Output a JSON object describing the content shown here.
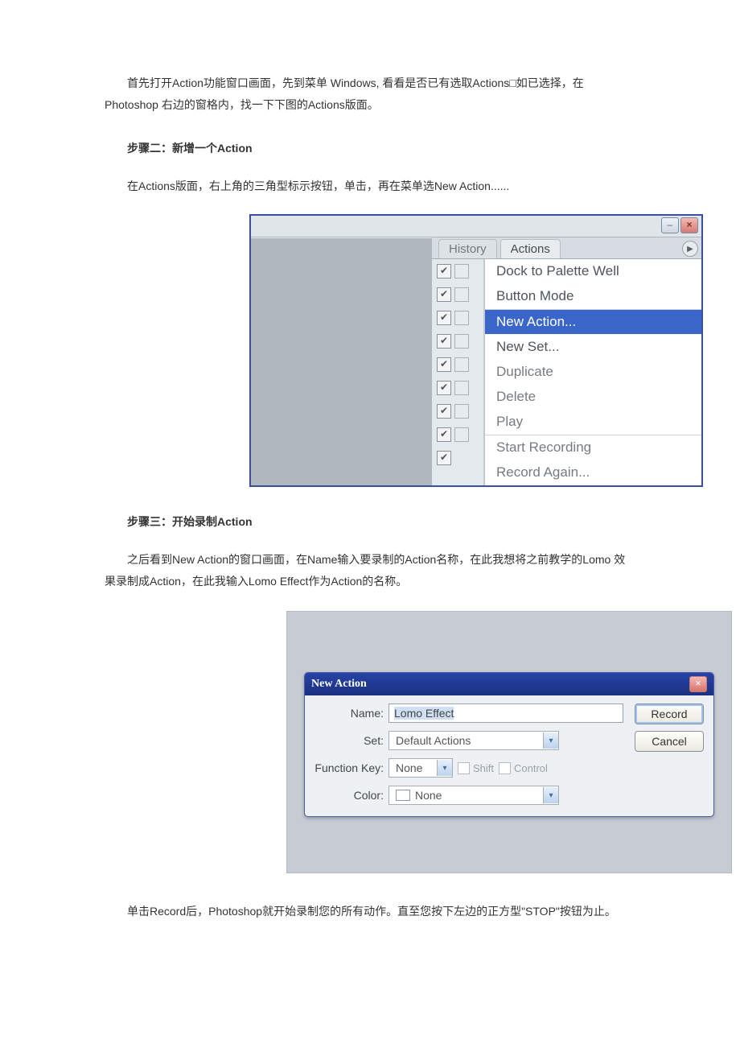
{
  "para": {
    "intro": "首先打开Action功能窗口画面，先到菜单 Windows, 看看是否已有选取Actions□如已选择，在 Photoshop 右边的窗格内，找一下下图的Actions版面。",
    "step2_title": "步骤二：新增一个Action",
    "step2_text": "在Actions版面，右上角的三角型标示按钮，单击，再在菜单选New Action......",
    "step3_title": "步骤三：开始录制Action",
    "step3_text": "之后看到New Action的窗口画面，在Name输入要录制的Action名称，在此我想将之前教学的Lomo 效果录制成Action，在此我输入Lomo Effect作为Action的名称。",
    "outro": "单击Record后，Photoshop就开始录制您的所有动作。直至您按下左边的正方型\"STOP\"按钮为止。"
  },
  "fig1": {
    "tabs": {
      "history": "History",
      "actions": "Actions"
    },
    "menu": {
      "dock": "Dock to Palette Well",
      "button_mode": "Button Mode",
      "new_action": "New Action...",
      "new_set": "New Set...",
      "duplicate": "Duplicate",
      "delete": "Delete",
      "play": "Play",
      "start_rec": "Start Recording",
      "rec_again": "Record Again..."
    }
  },
  "fig2": {
    "title": "New Action",
    "labels": {
      "name": "Name:",
      "set": "Set:",
      "fkey": "Function Key:",
      "color": "Color:",
      "shift": "Shift",
      "control": "Control"
    },
    "values": {
      "name": "Lomo Effect",
      "set": "Default Actions",
      "fkey": "None",
      "color": "None"
    },
    "buttons": {
      "record": "Record",
      "cancel": "Cancel"
    }
  }
}
